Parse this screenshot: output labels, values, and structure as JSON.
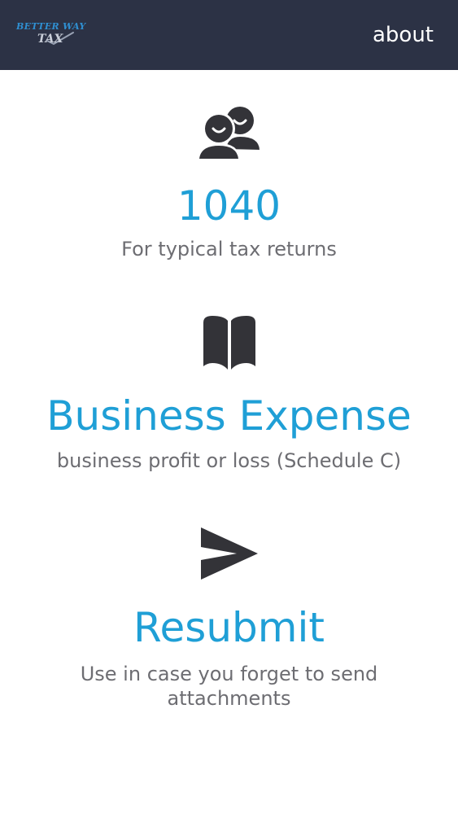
{
  "header": {
    "logo": {
      "line1": "BETTER WAY",
      "line2": "TAX"
    },
    "about_label": "about",
    "background_color": "#2c3245"
  },
  "options": [
    {
      "icon": "users-icon",
      "title": "1040",
      "description": "For typical tax returns"
    },
    {
      "icon": "book-icon",
      "title": "Business Expense",
      "description": "business profit or loss (Schedule C)"
    },
    {
      "icon": "send-icon",
      "title": "Resubmit",
      "description": "Use in case you forget to send attachments"
    }
  ],
  "colors": {
    "accent": "#1f9fd6",
    "text_secondary": "#6d6d72",
    "icon": "#333338"
  }
}
